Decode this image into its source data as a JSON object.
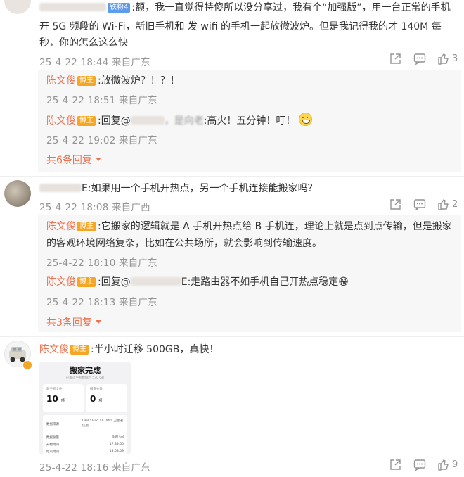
{
  "colors": {
    "accent": "#eb7350",
    "meta": "#939393",
    "reply_bg": "#f7f7f7",
    "host_badge": "#f5a623",
    "fan_badge": "#5d9cec"
  },
  "comment1": {
    "fan_badge": "铁粉4",
    "text_line1": ":额，我一直觉得特傻所以没分享过，我有个“加强版”，用一台正常的手机",
    "text_line2": "开 5G 频段的 Wi-Fi，新旧手机和 发 wifi 的手机一起放微波炉。但是我记得我的才 140M 每",
    "text_line3": "秒，你的怎么这么快",
    "time": "25-4-22 18:44 来自广东",
    "likes": "3",
    "replies": [
      {
        "name": "陈文俊",
        "badge": "博主",
        "text": ":放微波炉？！？！",
        "time": "25-4-22 18:51 来自广东"
      },
      {
        "name": "陈文俊",
        "badge": "博主",
        "prefix": ":回复@",
        "mid": "，是向老",
        "text": ":高火！五分钟！叮！",
        "time": "25-4-22 19:02 来自广东"
      }
    ],
    "more": "共6条回复"
  },
  "comment2": {
    "name_tail": "E",
    "text": ":如果用一个手机开热点，另一个手机连接能搬家吗？",
    "time": "25-4-22 18:08 来自广西",
    "likes": "2",
    "replies": [
      {
        "name": "陈文俊",
        "badge": "博主",
        "text_line1": ":它搬家的逻辑就是 A 手机开热点给 B 手机连，理论上就是点到点传输，但是搬家",
        "text_line2": "的客观环境网络复杂，比如在公共场所，就会影响到传输速度。",
        "time": "25-4-22 18:10 来自广东"
      },
      {
        "name": "陈文俊",
        "badge": "博主",
        "prefix": ":回复@",
        "mid": "E",
        "text": ":走路由器不如手机自己开热点稳定😁",
        "time": "25-4-22 18:13 来自广东"
      }
    ],
    "more": "共3条回复"
  },
  "comment3": {
    "name": "陈文俊",
    "badge": "博主",
    "text": ":半小时迁移 500GB，真快！",
    "time": "25-4-22 18:16 来自广东",
    "likes": "9",
    "image": {
      "title": "搬家完成",
      "subtitle": "已搬迁手机数据约 570 GB",
      "stat1_label": "新手机文件",
      "stat1_value": "10",
      "stat1_unit": "项",
      "stat2_label": "搬家失败",
      "stat2_value": "0",
      "stat2_unit": "项",
      "row0_label": "数据来源",
      "row0_value": "OPPO Find X8 Ultra 卫星通信版",
      "row1_label": "数据总量",
      "row1_value": "440 GB",
      "row2_label": "开始时间",
      "row2_value": "17:33:50",
      "row3_label": "结束时间",
      "row3_value": "18:03:09"
    }
  }
}
